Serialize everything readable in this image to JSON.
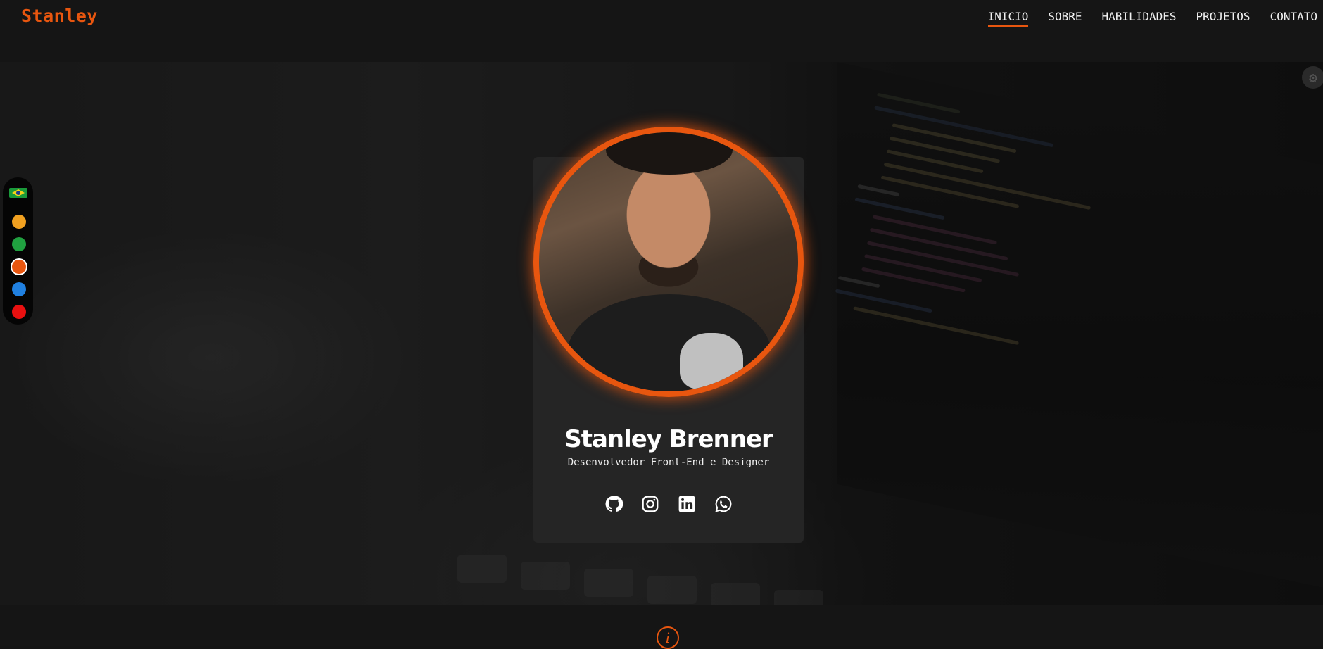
{
  "brand": "Stanley",
  "nav": {
    "items": [
      {
        "label": "INICIO",
        "active": true
      },
      {
        "label": "SOBRE",
        "active": false
      },
      {
        "label": "HABILIDADES",
        "active": false
      },
      {
        "label": "PROJETOS",
        "active": false
      },
      {
        "label": "CONTATO",
        "active": false
      }
    ]
  },
  "theme_switcher": {
    "language_flag": "brazil-flag-icon",
    "colors": [
      "#f0a020",
      "#20a040",
      "#e8560f",
      "#2080e0",
      "#e81010"
    ],
    "selected_color": "#e8560f"
  },
  "profile": {
    "name": "Stanley Brenner",
    "role": "Desenvolvedor Front-End e Designer",
    "socials": [
      "github-icon",
      "instagram-icon",
      "linkedin-icon",
      "whatsapp-icon"
    ]
  },
  "accent_color": "#e8560f",
  "section_icon": "i"
}
